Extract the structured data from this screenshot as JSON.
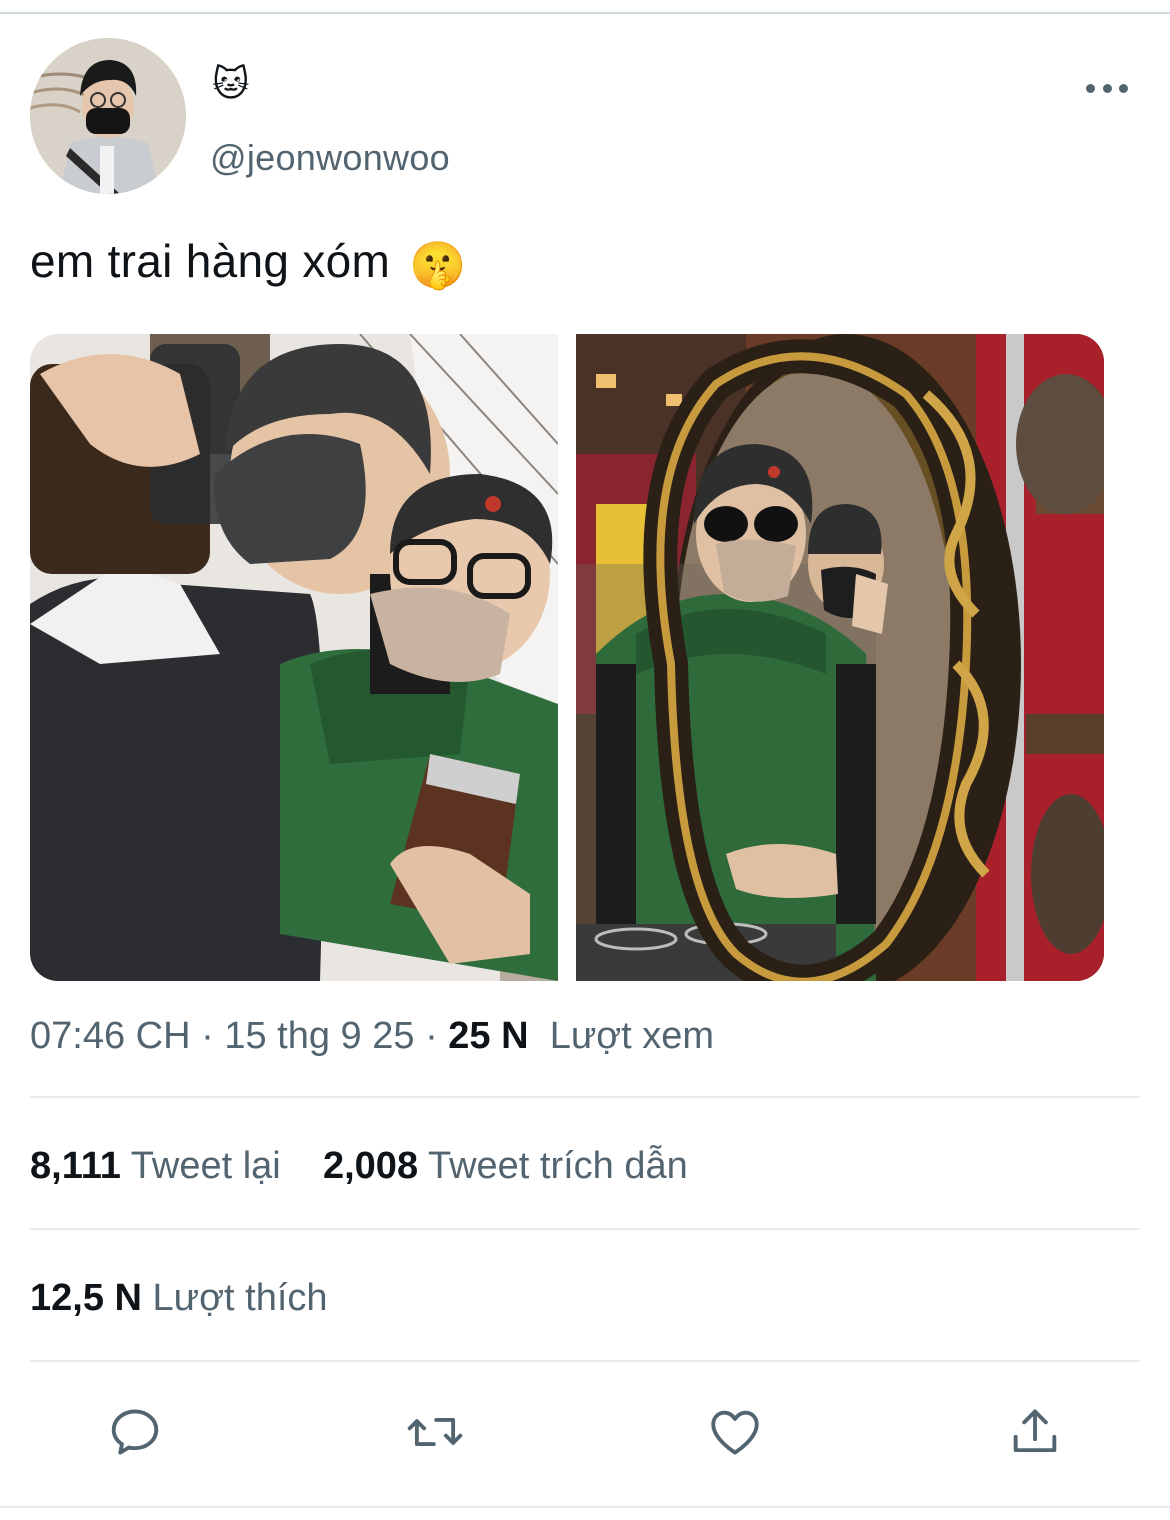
{
  "user": {
    "display_name": "🐱",
    "handle": "@jeonwonwoo"
  },
  "tweet": {
    "text": "em trai hàng xóm",
    "emoji": "🤫"
  },
  "media": {
    "photos": [
      {
        "description_icon": "photo-selfie"
      },
      {
        "description_icon": "photo-mirror"
      }
    ]
  },
  "meta": {
    "time": "07:46 CH",
    "separator": "·",
    "date": "15 thg 9 25",
    "views_count": "25 N",
    "views_label": "Lượt xem"
  },
  "stats": {
    "retweets_count": "8,111",
    "retweets_label": "Tweet lại",
    "quotes_count": "2,008",
    "quotes_label": "Tweet trích dẫn",
    "likes_count": "12,5 N",
    "likes_label": "Lượt thích"
  },
  "actions": [
    {
      "icon": "reply-icon"
    },
    {
      "icon": "retweet-icon"
    },
    {
      "icon": "like-icon"
    },
    {
      "icon": "share-icon"
    }
  ],
  "colors": {
    "text_primary": "#0f1419",
    "text_secondary": "#536471",
    "divider": "#e6ecf0"
  }
}
